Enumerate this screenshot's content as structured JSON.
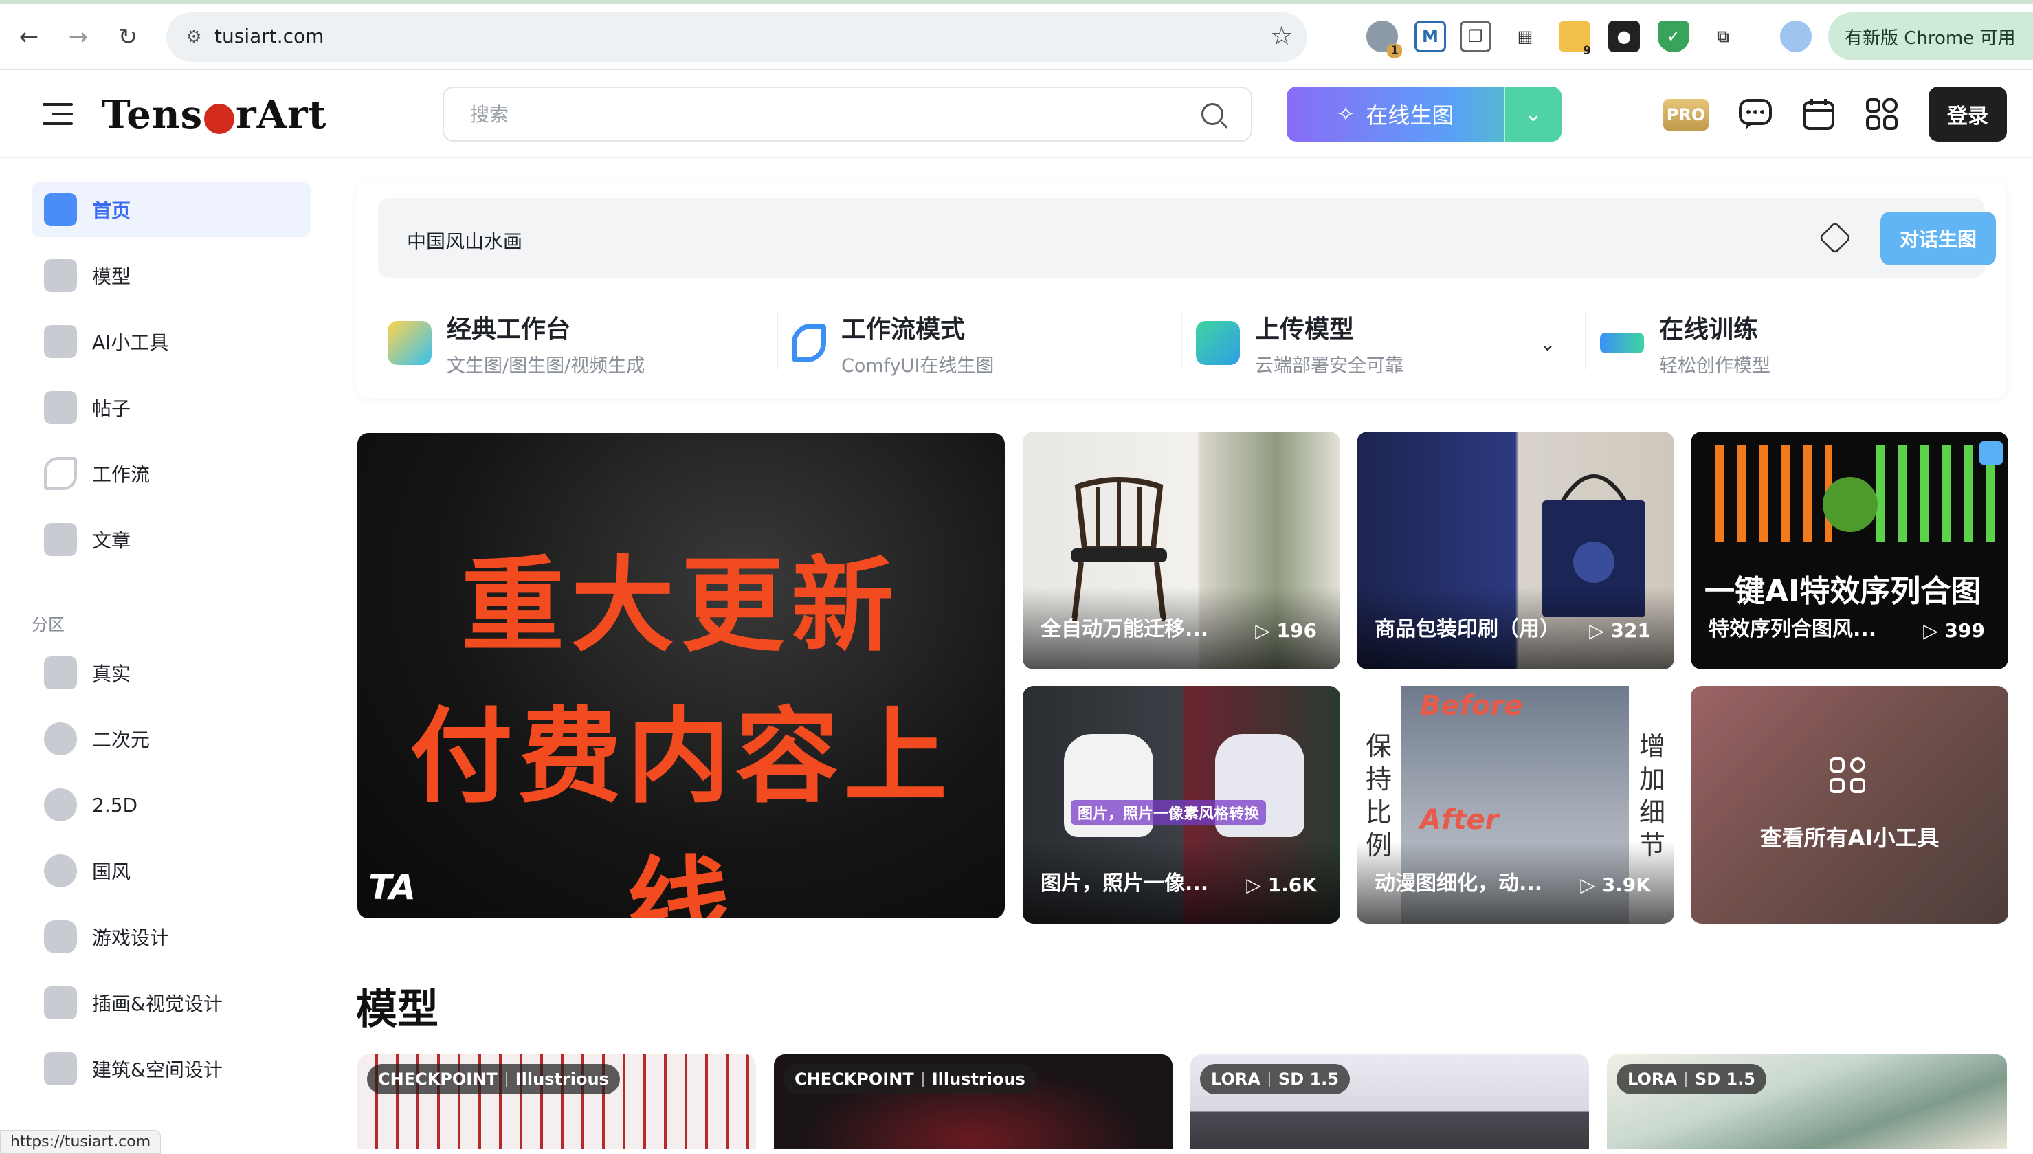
{
  "browser": {
    "url": "tusiart.com",
    "update_label": "有新版 Chrome 可用",
    "ext_badge_1": "1",
    "ext_badge_2": "9"
  },
  "header": {
    "logo_left": "Tens",
    "logo_right": "rArt",
    "search_placeholder": "搜索",
    "generate_label": "在线生图",
    "pro_label": "PRO",
    "login_label": "登录"
  },
  "sidebar": {
    "items": [
      {
        "label": "首页"
      },
      {
        "label": "模型"
      },
      {
        "label": "AI小工具"
      },
      {
        "label": "帖子"
      },
      {
        "label": "工作流"
      },
      {
        "label": "文章"
      }
    ],
    "section_label": "分区",
    "zones": [
      {
        "label": "真实"
      },
      {
        "label": "二次元"
      },
      {
        "label": "2.5D"
      },
      {
        "label": "国风"
      },
      {
        "label": "游戏设计"
      },
      {
        "label": "插画&视觉设计"
      },
      {
        "label": "建筑&空间设计"
      }
    ]
  },
  "prompt": {
    "text": "中国风山水画",
    "chat_generate_label": "对话生图"
  },
  "modes": [
    {
      "title": "经典工作台",
      "subtitle": "文生图/图生图/视频生成"
    },
    {
      "title": "工作流模式",
      "subtitle": "ComfyUI在线生图"
    },
    {
      "title": "上传模型",
      "subtitle": "云端部署安全可靠"
    },
    {
      "title": "在线训练",
      "subtitle": "轻松创作模型"
    }
  ],
  "banner": {
    "line1": "重大更新",
    "line2": "付费内容上线",
    "brand": "TA"
  },
  "tools": [
    {
      "name": "全自动万能迁移...",
      "count": "▷ 196"
    },
    {
      "name": "商品包装印刷（用）",
      "count": "▷ 321"
    },
    {
      "name": "特效序列合图风...",
      "count": "▷ 399",
      "overlay": "一键AI特效序列合图"
    },
    {
      "name": "图片，照片一像...",
      "count": "▷ 1.6K",
      "overlay": "图片，照片一像素风格转换"
    },
    {
      "name": "动漫图细化，动...",
      "count": "▷ 3.9K",
      "left_text": "保持比例",
      "right_text": "增加细节",
      "before": "Before",
      "after": "After"
    },
    {
      "name": "查看所有AI小工具"
    }
  ],
  "models_title": "模型",
  "models": [
    {
      "type": "CHECKPOINT",
      "base": "Illustrious"
    },
    {
      "type": "CHECKPOINT",
      "base": "Illustrious"
    },
    {
      "type": "LORA",
      "base": "SD 1.5"
    },
    {
      "type": "LORA",
      "base": "SD 1.5"
    }
  ],
  "status_url": "https://tusiart.com"
}
